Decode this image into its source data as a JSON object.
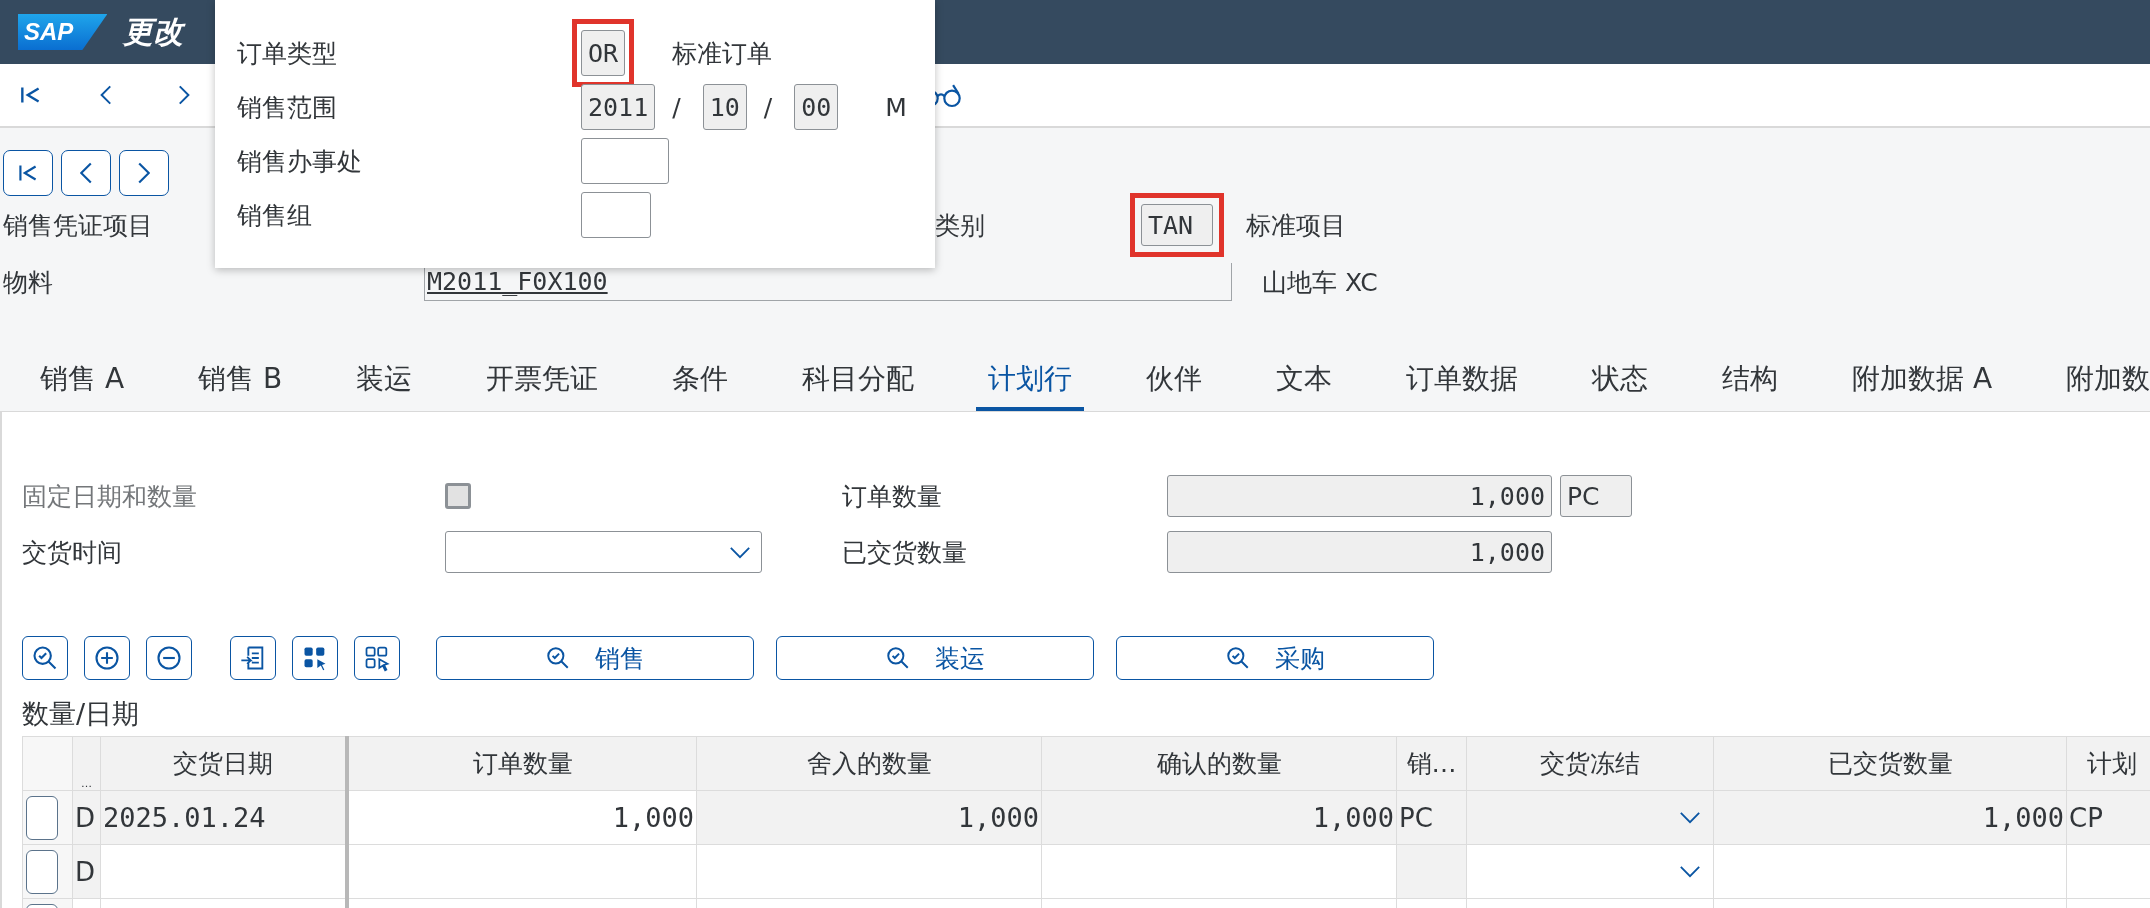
{
  "shell": {
    "logo": "SAP",
    "title": "更改"
  },
  "header": {
    "item_label": "销售凭证项目",
    "category_label": "类别",
    "category": {
      "value": "TAN",
      "highlighted": true
    },
    "category_text": "标准项目",
    "material_label": "物料",
    "material": "M2011_F0X100",
    "material_text": "山地车 XC"
  },
  "popup": {
    "rows": [
      {
        "label": "订单类型",
        "parts": [
          {
            "kind": "field",
            "value": "OR",
            "highlighted": true
          },
          {
            "kind": "text",
            "text": "标准订单"
          }
        ]
      },
      {
        "label": "销售范围",
        "parts": [
          {
            "kind": "field",
            "value": "2011",
            "highlighted": false
          },
          {
            "kind": "sep",
            "text": "/"
          },
          {
            "kind": "field",
            "value": "10",
            "highlighted": false
          },
          {
            "kind": "sep",
            "text": "/"
          },
          {
            "kind": "field",
            "value": "00",
            "highlighted": false
          },
          {
            "kind": "text",
            "text": "M"
          }
        ]
      },
      {
        "label": "销售办事处",
        "parts": [
          {
            "kind": "field",
            "highlighted": false
          }
        ]
      },
      {
        "label": "销售组",
        "parts": [
          {
            "kind": "field",
            "highlighted": false
          }
        ]
      }
    ]
  },
  "tabs": [
    {
      "label": "销售 A",
      "selected": false
    },
    {
      "label": "销售 B",
      "selected": false
    },
    {
      "label": "装运",
      "selected": false
    },
    {
      "label": "开票凭证",
      "selected": false
    },
    {
      "label": "条件",
      "selected": false
    },
    {
      "label": "科目分配",
      "selected": false
    },
    {
      "label": "计划行",
      "selected": true
    },
    {
      "label": "伙伴",
      "selected": false
    },
    {
      "label": "文本",
      "selected": false
    },
    {
      "label": "订单数据",
      "selected": false
    },
    {
      "label": "状态",
      "selected": false
    },
    {
      "label": "结构",
      "selected": false
    },
    {
      "label": "附加数据 A",
      "selected": false
    },
    {
      "label": "附加数",
      "selected": false
    }
  ],
  "form": {
    "fixed_label": "固定日期和数量",
    "fixed_checked": false,
    "fixed_disabled": true,
    "delivery_time_label": "交货时间",
    "order_qty_label": "订单数量",
    "order_qty": "1,000",
    "unit": "PC",
    "delivered_qty_label": "已交货数量",
    "delivered_qty": "1,000"
  },
  "table_buttons": [
    "销售",
    "装运",
    "采购"
  ],
  "table": {
    "title": "数量/日期",
    "columns": [
      "…",
      "交货日期",
      "订单数量",
      "舍入的数量",
      "确认的数量",
      "销…",
      "交货冻结",
      "已交货数量",
      "计划"
    ],
    "rows": [
      {
        "kind": "saved",
        "category": "D",
        "date": "2025.01.24",
        "order_qty": "1,000",
        "rounded_qty": "1,000",
        "confirmed_qty": "1,000",
        "unit": "PC",
        "delivered_qty": "1,000",
        "schedule_type": "CP"
      },
      {
        "kind": "new",
        "category": "D"
      },
      {
        "kind": "partial"
      }
    ]
  }
}
